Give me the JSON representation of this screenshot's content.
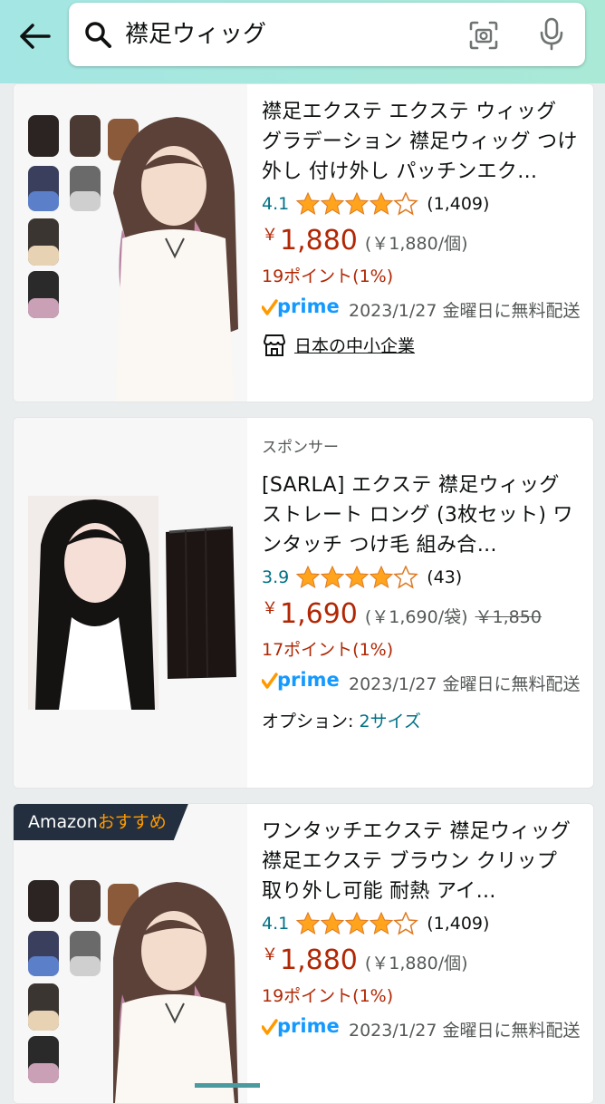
{
  "search": {
    "query": "襟足ウィッグ"
  },
  "products": [
    {
      "sponsored": "",
      "title": "襟足エクステ エクステ ウィッグ グラデーション 襟足ウィッグ つけ外し 付け外し パッチンエク…",
      "rating": "4.1",
      "stars": 4,
      "rating_count": "(1,409)",
      "yen": "￥",
      "price": "1,880",
      "unit_price": "(￥1,880/個)",
      "list_price": "",
      "points": "19ポイント(1%)",
      "prime_label": "prime",
      "delivery": "2023/1/27 金曜日に無料配送",
      "small_business": "日本の中小企業"
    },
    {
      "sponsored": "スポンサー",
      "title": "[SARLA] エクステ 襟足ウィッグ ストレート ロング (3枚セット) ワンタッチ つけ毛 組み合…",
      "rating": "3.9",
      "stars": 4,
      "rating_count": "(43)",
      "yen": "￥",
      "price": "1,690",
      "unit_price": "(￥1,690/袋)",
      "list_price": "￥1,850",
      "points": "17ポイント(1%)",
      "prime_label": "prime",
      "delivery": "2023/1/27 金曜日に無料配送",
      "option_label": "オプション:",
      "option_value": "2サイズ"
    },
    {
      "badge_prefix": "Amazon",
      "badge_accent": "おすすめ",
      "title": "ワンタッチエクステ 襟足ウィッグ 襟足エクステ ブラウン クリップ 取り外し可能 耐熱 アイ…",
      "rating": "4.1",
      "stars": 4,
      "rating_count": "(1,409)",
      "yen": "￥",
      "price": "1,880",
      "unit_price": "(￥1,880/個)",
      "points": "19ポイント(1%)",
      "prime_label": "prime",
      "delivery": "2023/1/27 金曜日に無料配送"
    }
  ],
  "colors": {
    "price": "#b12704",
    "link": "#007185",
    "star": "#ffa41c",
    "prime": "#1399ff"
  }
}
